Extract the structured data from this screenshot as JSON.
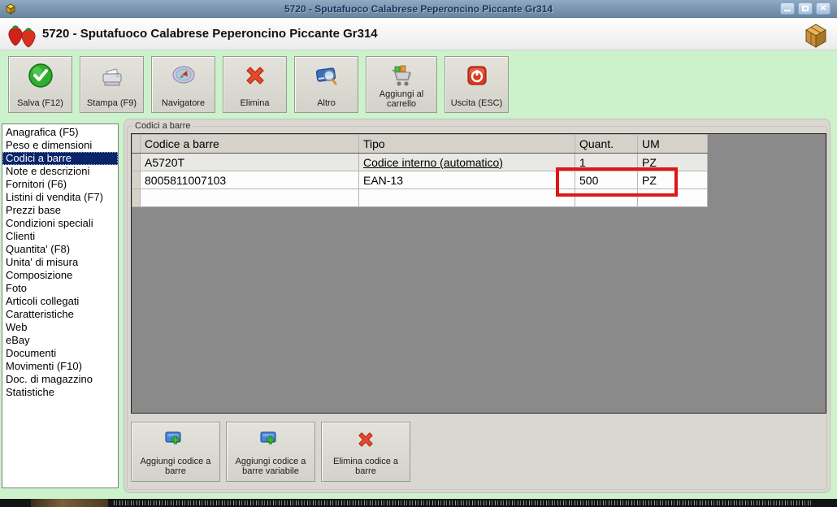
{
  "window": {
    "title": "5720 - Sputafuoco Calabrese Peperoncino Piccante Gr314"
  },
  "header": {
    "title": "5720 - Sputafuoco Calabrese Peperoncino Piccante Gr314"
  },
  "icons": {
    "titlebar_left": "package-cube-icon",
    "header_left": "strawberries-icon",
    "header_right": "package-box-icon",
    "window_controls": [
      "minimize-icon",
      "maximize-icon",
      "close-icon"
    ]
  },
  "toolbar": {
    "buttons": [
      {
        "label": "Salva (F12)",
        "icon": "check-circle-icon"
      },
      {
        "label": "Stampa (F9)",
        "icon": "printer-icon"
      },
      {
        "label": "Navigatore",
        "icon": "compass-icon"
      },
      {
        "label": "Elimina",
        "icon": "red-x-icon"
      },
      {
        "label": "Altro",
        "icon": "book-search-icon"
      },
      {
        "label": "Aggiungi al carrello",
        "icon": "shopping-cart-icon"
      },
      {
        "label": "Uscita (ESC)",
        "icon": "power-icon"
      }
    ]
  },
  "sidebar": {
    "items": [
      {
        "label": "Anagrafica (F5)"
      },
      {
        "label": "Peso e dimensioni"
      },
      {
        "label": "Codici a barre",
        "selected": true
      },
      {
        "label": "Note e descrizioni"
      },
      {
        "label": "Fornitori (F6)"
      },
      {
        "label": "Listini di vendita (F7)"
      },
      {
        "label": "Prezzi base"
      },
      {
        "label": "Condizioni speciali"
      },
      {
        "label": "Clienti"
      },
      {
        "label": "Quantita' (F8)"
      },
      {
        "label": "Unita' di misura"
      },
      {
        "label": "Composizione"
      },
      {
        "label": "Foto"
      },
      {
        "label": "Articoli collegati"
      },
      {
        "label": "Caratteristiche"
      },
      {
        "label": "Web"
      },
      {
        "label": "eBay"
      },
      {
        "label": "Documenti"
      },
      {
        "label": "Movimenti (F10)"
      },
      {
        "label": "Doc. di magazzino"
      },
      {
        "label": "Statistiche"
      }
    ]
  },
  "main": {
    "group_label": "Codici a barre",
    "table": {
      "headers": [
        "Codice a barre",
        "Tipo",
        "Quant.",
        "UM"
      ],
      "rows": [
        {
          "code": "A5720T",
          "tipo": "Codice interno (automatico)",
          "quant": "1",
          "um": "PZ"
        },
        {
          "code": "8005811007103",
          "tipo": "EAN-13",
          "quant": "500",
          "um": "PZ"
        },
        {
          "code": "",
          "tipo": "",
          "quant": "",
          "um": ""
        }
      ]
    },
    "highlight": {
      "color": "#e01616",
      "around": "500 PZ"
    },
    "buttons": [
      {
        "label": "Aggiungi codice a barre",
        "icon": "barcode-add-icon"
      },
      {
        "label": "Aggiungi codice a barre variabile",
        "icon": "barcode-add-icon"
      },
      {
        "label": "Elimina codice a barre",
        "icon": "red-x-icon"
      }
    ]
  },
  "colors": {
    "app_background": "#ccf2cc",
    "titlebar_blue": "#7a94b0",
    "selection_blue": "#0a246a",
    "canvas_gray": "#8a8a8a",
    "highlight_red": "#e01616"
  }
}
